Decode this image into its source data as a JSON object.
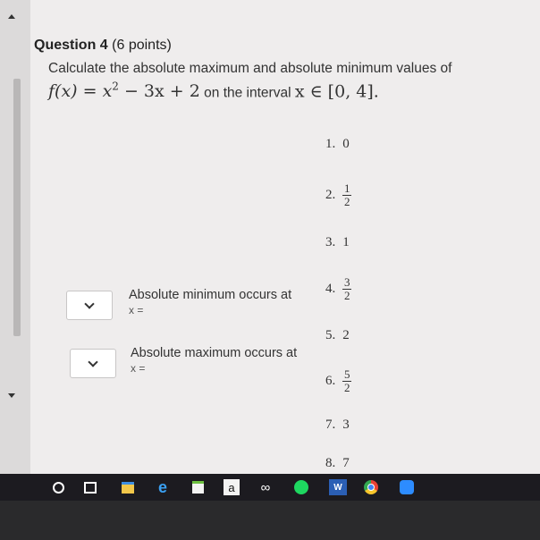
{
  "question": {
    "title": "Question 4",
    "points": "(6 points)",
    "text_line1": "Calculate the absolute maximum and absolute minimum values of",
    "func_lhs": "f(x) = x",
    "func_exp": "2",
    "func_rhs": " − 3x + 2",
    "interval_text": "on the interval",
    "interval_math": "x ∈ [0, 4]."
  },
  "options": [
    {
      "num": "1.",
      "value": "0"
    },
    {
      "num": "2.",
      "numer": "1",
      "denom": "2"
    },
    {
      "num": "3.",
      "value": "1"
    },
    {
      "num": "4.",
      "numer": "3",
      "denom": "2"
    },
    {
      "num": "5.",
      "value": "2"
    },
    {
      "num": "6.",
      "numer": "5",
      "denom": "2"
    },
    {
      "num": "7.",
      "value": "3"
    },
    {
      "num": "8.",
      "value": "7"
    }
  ],
  "prompts": {
    "min_label": "Absolute minimum occurs at",
    "min_sub": "x =",
    "max_label": "Absolute maximum occurs at",
    "max_sub": "x ="
  },
  "taskbar": {
    "icons": [
      "circle-icon",
      "task-view-icon",
      "file-explorer-icon",
      "edge-icon",
      "store-icon",
      "amazon-icon",
      "infinity-icon",
      "spotify-icon",
      "word-icon",
      "chrome-icon",
      "zoom-icon"
    ],
    "amazon_letter": "a",
    "word_letter": "W"
  }
}
